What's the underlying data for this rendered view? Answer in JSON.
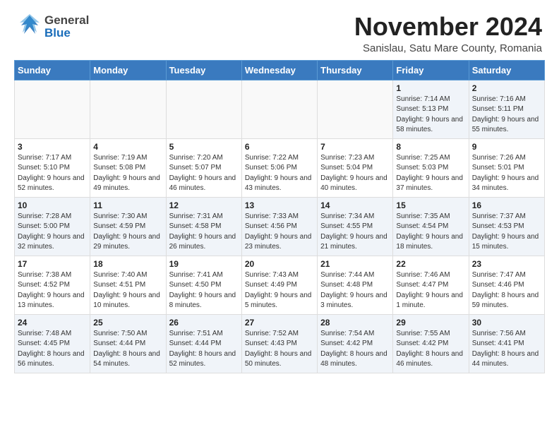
{
  "header": {
    "logo_general": "General",
    "logo_blue": "Blue",
    "month_title": "November 2024",
    "subtitle": "Sanislau, Satu Mare County, Romania"
  },
  "weekdays": [
    "Sunday",
    "Monday",
    "Tuesday",
    "Wednesday",
    "Thursday",
    "Friday",
    "Saturday"
  ],
  "weeks": [
    [
      {
        "day": "",
        "info": ""
      },
      {
        "day": "",
        "info": ""
      },
      {
        "day": "",
        "info": ""
      },
      {
        "day": "",
        "info": ""
      },
      {
        "day": "",
        "info": ""
      },
      {
        "day": "1",
        "info": "Sunrise: 7:14 AM\nSunset: 5:13 PM\nDaylight: 9 hours and 58 minutes."
      },
      {
        "day": "2",
        "info": "Sunrise: 7:16 AM\nSunset: 5:11 PM\nDaylight: 9 hours and 55 minutes."
      }
    ],
    [
      {
        "day": "3",
        "info": "Sunrise: 7:17 AM\nSunset: 5:10 PM\nDaylight: 9 hours and 52 minutes."
      },
      {
        "day": "4",
        "info": "Sunrise: 7:19 AM\nSunset: 5:08 PM\nDaylight: 9 hours and 49 minutes."
      },
      {
        "day": "5",
        "info": "Sunrise: 7:20 AM\nSunset: 5:07 PM\nDaylight: 9 hours and 46 minutes."
      },
      {
        "day": "6",
        "info": "Sunrise: 7:22 AM\nSunset: 5:06 PM\nDaylight: 9 hours and 43 minutes."
      },
      {
        "day": "7",
        "info": "Sunrise: 7:23 AM\nSunset: 5:04 PM\nDaylight: 9 hours and 40 minutes."
      },
      {
        "day": "8",
        "info": "Sunrise: 7:25 AM\nSunset: 5:03 PM\nDaylight: 9 hours and 37 minutes."
      },
      {
        "day": "9",
        "info": "Sunrise: 7:26 AM\nSunset: 5:01 PM\nDaylight: 9 hours and 34 minutes."
      }
    ],
    [
      {
        "day": "10",
        "info": "Sunrise: 7:28 AM\nSunset: 5:00 PM\nDaylight: 9 hours and 32 minutes."
      },
      {
        "day": "11",
        "info": "Sunrise: 7:30 AM\nSunset: 4:59 PM\nDaylight: 9 hours and 29 minutes."
      },
      {
        "day": "12",
        "info": "Sunrise: 7:31 AM\nSunset: 4:58 PM\nDaylight: 9 hours and 26 minutes."
      },
      {
        "day": "13",
        "info": "Sunrise: 7:33 AM\nSunset: 4:56 PM\nDaylight: 9 hours and 23 minutes."
      },
      {
        "day": "14",
        "info": "Sunrise: 7:34 AM\nSunset: 4:55 PM\nDaylight: 9 hours and 21 minutes."
      },
      {
        "day": "15",
        "info": "Sunrise: 7:35 AM\nSunset: 4:54 PM\nDaylight: 9 hours and 18 minutes."
      },
      {
        "day": "16",
        "info": "Sunrise: 7:37 AM\nSunset: 4:53 PM\nDaylight: 9 hours and 15 minutes."
      }
    ],
    [
      {
        "day": "17",
        "info": "Sunrise: 7:38 AM\nSunset: 4:52 PM\nDaylight: 9 hours and 13 minutes."
      },
      {
        "day": "18",
        "info": "Sunrise: 7:40 AM\nSunset: 4:51 PM\nDaylight: 9 hours and 10 minutes."
      },
      {
        "day": "19",
        "info": "Sunrise: 7:41 AM\nSunset: 4:50 PM\nDaylight: 9 hours and 8 minutes."
      },
      {
        "day": "20",
        "info": "Sunrise: 7:43 AM\nSunset: 4:49 PM\nDaylight: 9 hours and 5 minutes."
      },
      {
        "day": "21",
        "info": "Sunrise: 7:44 AM\nSunset: 4:48 PM\nDaylight: 9 hours and 3 minutes."
      },
      {
        "day": "22",
        "info": "Sunrise: 7:46 AM\nSunset: 4:47 PM\nDaylight: 9 hours and 1 minute."
      },
      {
        "day": "23",
        "info": "Sunrise: 7:47 AM\nSunset: 4:46 PM\nDaylight: 8 hours and 59 minutes."
      }
    ],
    [
      {
        "day": "24",
        "info": "Sunrise: 7:48 AM\nSunset: 4:45 PM\nDaylight: 8 hours and 56 minutes."
      },
      {
        "day": "25",
        "info": "Sunrise: 7:50 AM\nSunset: 4:44 PM\nDaylight: 8 hours and 54 minutes."
      },
      {
        "day": "26",
        "info": "Sunrise: 7:51 AM\nSunset: 4:44 PM\nDaylight: 8 hours and 52 minutes."
      },
      {
        "day": "27",
        "info": "Sunrise: 7:52 AM\nSunset: 4:43 PM\nDaylight: 8 hours and 50 minutes."
      },
      {
        "day": "28",
        "info": "Sunrise: 7:54 AM\nSunset: 4:42 PM\nDaylight: 8 hours and 48 minutes."
      },
      {
        "day": "29",
        "info": "Sunrise: 7:55 AM\nSunset: 4:42 PM\nDaylight: 8 hours and 46 minutes."
      },
      {
        "day": "30",
        "info": "Sunrise: 7:56 AM\nSunset: 4:41 PM\nDaylight: 8 hours and 44 minutes."
      }
    ]
  ]
}
